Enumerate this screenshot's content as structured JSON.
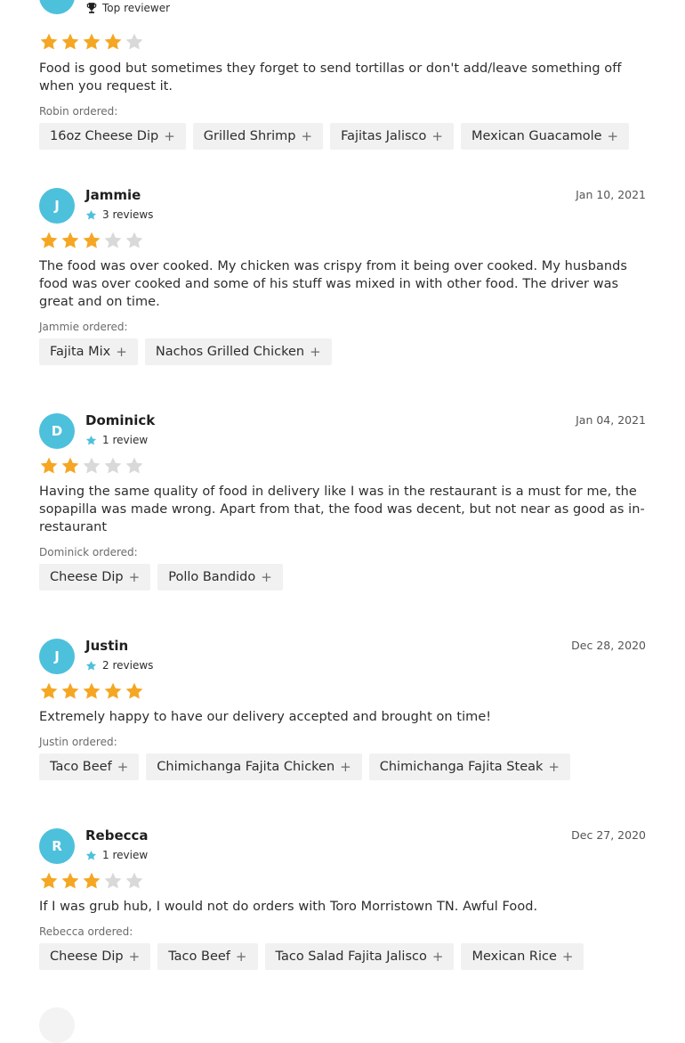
{
  "colors": {
    "accent": "#4dc0dc",
    "star_on": "#f5a623",
    "star_off": "#d9d9d9",
    "chip_bg": "#f1f1f1"
  },
  "first_review": {
    "badge": "Top reviewer",
    "rating": 4,
    "text": "Food is good but sometimes they forget to send tortillas or don't add/leave something off when you request it.",
    "ordered_label": "Robin ordered:",
    "items": [
      "16oz Cheese Dip",
      "Grilled Shrimp",
      "Fajitas Jalisco",
      "Mexican Guacamole"
    ]
  },
  "reviews": [
    {
      "initial": "J",
      "name": "Jammie",
      "review_count": "3 reviews",
      "date": "Jan 10, 2021",
      "rating": 3,
      "text": "The food was over cooked. My chicken was crispy from it being over cooked. My husbands food was over cooked and some of his stuff was mixed in with other food. The driver was great and on time.",
      "ordered_label": "Jammie ordered:",
      "items": [
        "Fajita Mix",
        "Nachos Grilled Chicken"
      ]
    },
    {
      "initial": "D",
      "name": "Dominick",
      "review_count": "1 review",
      "date": "Jan 04, 2021",
      "rating": 2,
      "text": "Having the same quality of food in delivery like I was in the restaurant is a must for me, the sopapilla was made wrong. Apart from that, the food was decent, but not near as good as in-restaurant",
      "ordered_label": "Dominick ordered:",
      "items": [
        "Cheese Dip",
        "Pollo Bandido"
      ]
    },
    {
      "initial": "J",
      "name": "Justin",
      "review_count": "2 reviews",
      "date": "Dec 28, 2020",
      "rating": 5,
      "text": "Extremely happy to have our delivery accepted and brought on time!",
      "ordered_label": "Justin ordered:",
      "items": [
        "Taco Beef",
        "Chimichanga Fajita Chicken",
        "Chimichanga Fajita Steak"
      ]
    },
    {
      "initial": "R",
      "name": "Rebecca",
      "review_count": "1 review",
      "date": "Dec 27, 2020",
      "rating": 3,
      "text": "If I was grub hub, I would not do orders with Toro Morristown TN. Awful Food.",
      "ordered_label": "Rebecca ordered:",
      "items": [
        "Cheese Dip",
        "Taco Beef",
        "Taco Salad Fajita Jalisco",
        "Mexican Rice"
      ]
    }
  ]
}
